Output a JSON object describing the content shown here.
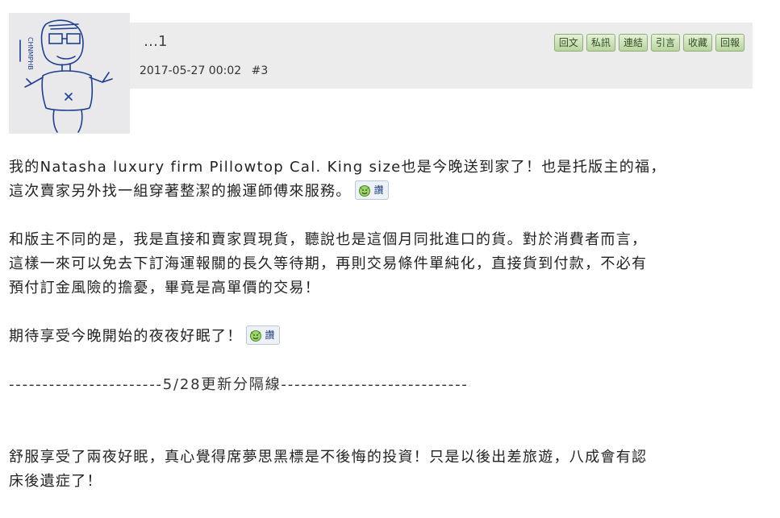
{
  "post": {
    "username": "…1",
    "date": "2017-05-27 00:02",
    "floor": "#3",
    "actions": [
      "回文",
      "私訊",
      "連結",
      "引言",
      "收藏",
      "回報"
    ]
  },
  "content": {
    "para1_line1": "我的Natasha luxury firm Pillowtop Cal. King size也是今晚送到家了！也是托版主的福，",
    "para1_line2": "這次賣家另外找一組穿著整潔的搬運師傅來服務。",
    "para2_line1": "和版主不同的是，我是直接和賣家買現貨，聽說也是這個月同批進口的貨。對於消費者而言，",
    "para2_line2": "這樣一來可以免去下訂海運報關的長久等待期，再則交易條件單純化，直接貨到付款，不必有",
    "para2_line3": "預付訂金風險的擔憂，畢竟是高單價的交易！",
    "para3_line1": "期待享受今晚開始的夜夜好眠了！",
    "divider": "-----------------------5/28更新分隔線----------------------------",
    "para4_line1": "舒服享受了兩夜好眠，真心覺得席夢思黑標是不後悔的投資！只是以後出差旅遊，八成會有認",
    "para4_line2": "床後遺症了！"
  },
  "emote": {
    "label": "讚",
    "icon": "devil-smile-icon"
  }
}
